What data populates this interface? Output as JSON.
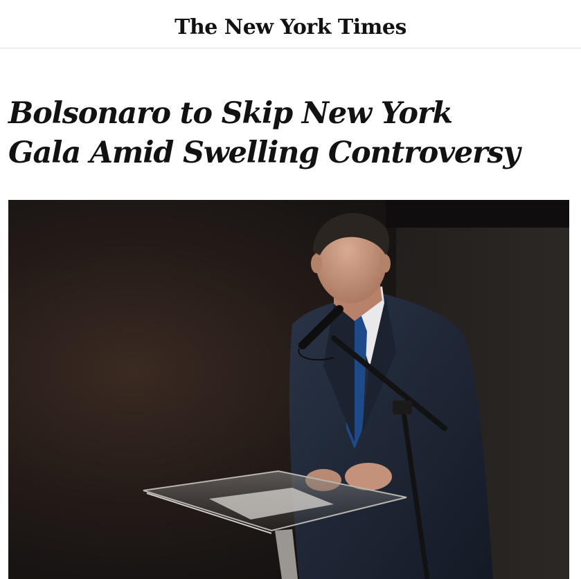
{
  "masthead": {
    "logo_text": "The New York Times"
  },
  "article": {
    "headline_line1": "Bolsonaro to Skip New York",
    "headline_line2": "Gala Amid Swelling Controversy"
  },
  "photo": {
    "subject": "man-speaking-at-podium",
    "colors": {
      "background": "#1c1715",
      "suit": "#1e2838",
      "tie": "#1f4a8a",
      "skin": "#c99a82"
    }
  }
}
